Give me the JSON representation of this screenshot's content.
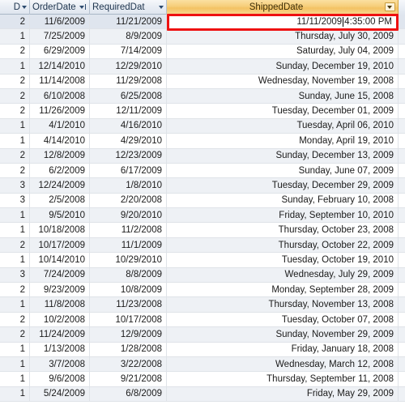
{
  "app": {
    "view": "datasheet",
    "accent_header_color": "#f3c263",
    "selection_row_color": "#dfe5ee",
    "annotation_color": "#ee1111"
  },
  "columns": [
    {
      "key": "id",
      "label": "D",
      "sort_indicator": "none",
      "filter_arrow": "caret",
      "selected": false
    },
    {
      "key": "order",
      "label": "OrderDate",
      "sort_indicator": "descending",
      "filter_arrow": "sort",
      "selected": false
    },
    {
      "key": "req",
      "label": "RequiredDat",
      "sort_indicator": "none",
      "filter_arrow": "caret",
      "selected": false
    },
    {
      "key": "ship",
      "label": "ShippedDate",
      "sort_indicator": "none",
      "filter_arrow": "filter",
      "selected": true
    }
  ],
  "editing": {
    "row_index": 0,
    "column": "ship",
    "value": "11/11/2009 4:35:00 PM",
    "caret_after": "11/11/2009"
  },
  "rows": [
    {
      "id": "2",
      "order": "11/6/2009",
      "req": "11/21/2009",
      "ship": "11/11/2009 4:35:00 PM"
    },
    {
      "id": "1",
      "order": "7/25/2009",
      "req": "8/9/2009",
      "ship": "Thursday, July 30, 2009"
    },
    {
      "id": "2",
      "order": "6/29/2009",
      "req": "7/14/2009",
      "ship": "Saturday, July 04, 2009"
    },
    {
      "id": "1",
      "order": "12/14/2010",
      "req": "12/29/2010",
      "ship": "Sunday, December 19, 2010"
    },
    {
      "id": "2",
      "order": "11/14/2008",
      "req": "11/29/2008",
      "ship": "Wednesday, November 19, 2008"
    },
    {
      "id": "2",
      "order": "6/10/2008",
      "req": "6/25/2008",
      "ship": "Sunday, June 15, 2008"
    },
    {
      "id": "2",
      "order": "11/26/2009",
      "req": "12/11/2009",
      "ship": "Tuesday, December 01, 2009"
    },
    {
      "id": "1",
      "order": "4/1/2010",
      "req": "4/16/2010",
      "ship": "Tuesday, April 06, 2010"
    },
    {
      "id": "1",
      "order": "4/14/2010",
      "req": "4/29/2010",
      "ship": "Monday, April 19, 2010"
    },
    {
      "id": "2",
      "order": "12/8/2009",
      "req": "12/23/2009",
      "ship": "Sunday, December 13, 2009"
    },
    {
      "id": "2",
      "order": "6/2/2009",
      "req": "6/17/2009",
      "ship": "Sunday, June 07, 2009"
    },
    {
      "id": "3",
      "order": "12/24/2009",
      "req": "1/8/2010",
      "ship": "Tuesday, December 29, 2009"
    },
    {
      "id": "3",
      "order": "2/5/2008",
      "req": "2/20/2008",
      "ship": "Sunday, February 10, 2008"
    },
    {
      "id": "1",
      "order": "9/5/2010",
      "req": "9/20/2010",
      "ship": "Friday, September 10, 2010"
    },
    {
      "id": "1",
      "order": "10/18/2008",
      "req": "11/2/2008",
      "ship": "Thursday, October 23, 2008"
    },
    {
      "id": "2",
      "order": "10/17/2009",
      "req": "11/1/2009",
      "ship": "Thursday, October 22, 2009"
    },
    {
      "id": "1",
      "order": "10/14/2010",
      "req": "10/29/2010",
      "ship": "Tuesday, October 19, 2010"
    },
    {
      "id": "3",
      "order": "7/24/2009",
      "req": "8/8/2009",
      "ship": "Wednesday, July 29, 2009"
    },
    {
      "id": "2",
      "order": "9/23/2009",
      "req": "10/8/2009",
      "ship": "Monday, September 28, 2009"
    },
    {
      "id": "1",
      "order": "11/8/2008",
      "req": "11/23/2008",
      "ship": "Thursday, November 13, 2008"
    },
    {
      "id": "2",
      "order": "10/2/2008",
      "req": "10/17/2008",
      "ship": "Tuesday, October 07, 2008"
    },
    {
      "id": "2",
      "order": "11/24/2009",
      "req": "12/9/2009",
      "ship": "Sunday, November 29, 2009"
    },
    {
      "id": "1",
      "order": "1/13/2008",
      "req": "1/28/2008",
      "ship": "Friday, January 18, 2008"
    },
    {
      "id": "1",
      "order": "3/7/2008",
      "req": "3/22/2008",
      "ship": "Wednesday, March 12, 2008"
    },
    {
      "id": "1",
      "order": "9/6/2008",
      "req": "9/21/2008",
      "ship": "Thursday, September 11, 2008"
    },
    {
      "id": "1",
      "order": "5/24/2009",
      "req": "6/8/2009",
      "ship": "Friday, May 29, 2009"
    }
  ]
}
